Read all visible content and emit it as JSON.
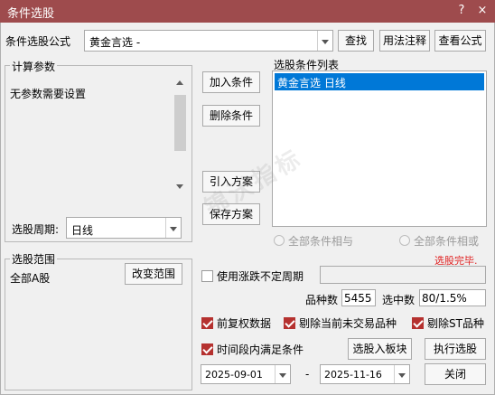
{
  "window": {
    "title": "条件选股",
    "help_glyph": "?",
    "close_glyph": "×"
  },
  "formula": {
    "label": "条件选股公式",
    "value": "黄金言选  -",
    "buttons": {
      "find": "查找",
      "usage": "用法注释",
      "view": "查看公式"
    }
  },
  "params": {
    "legend": "计算参数",
    "text": "无参数需要设置",
    "period_label": "选股周期:",
    "period_value": "日线"
  },
  "actions": {
    "add": "加入条件",
    "delete": "删除条件",
    "import": "引入方案",
    "save": "保存方案"
  },
  "conditions": {
    "legend": "选股条件列表",
    "items": [
      "黄金言选  日线"
    ],
    "radio_and": "全部条件相与",
    "radio_or": "全部条件相或",
    "status": "选股完毕."
  },
  "range": {
    "legend": "选股范围",
    "value": "全部A股",
    "change_button": "改变范围"
  },
  "options": {
    "uncertain_period": "使用涨跌不定周期",
    "count_label": "品种数",
    "count_value": "5455",
    "selected_label": "选中数",
    "selected_value": "80/1.5%",
    "pre_adjust": "前复权数据",
    "exclude_untraded": "剔除当前未交易品种",
    "exclude_st": "剔除ST品种",
    "period_condition": "时间段内满足条件"
  },
  "dates": {
    "start": "2025-09-01",
    "separator": "-",
    "end": "2025-11-16"
  },
  "bottom_buttons": {
    "add_to_block": "选股入板块",
    "execute": "执行选股",
    "close": "关闭"
  },
  "watermark": "锦沃指标",
  "colors": {
    "titlebar": "#9e4b4d",
    "selection": "#0078d7",
    "status": "#e02020",
    "checkbox_checked": "#b5312f"
  }
}
